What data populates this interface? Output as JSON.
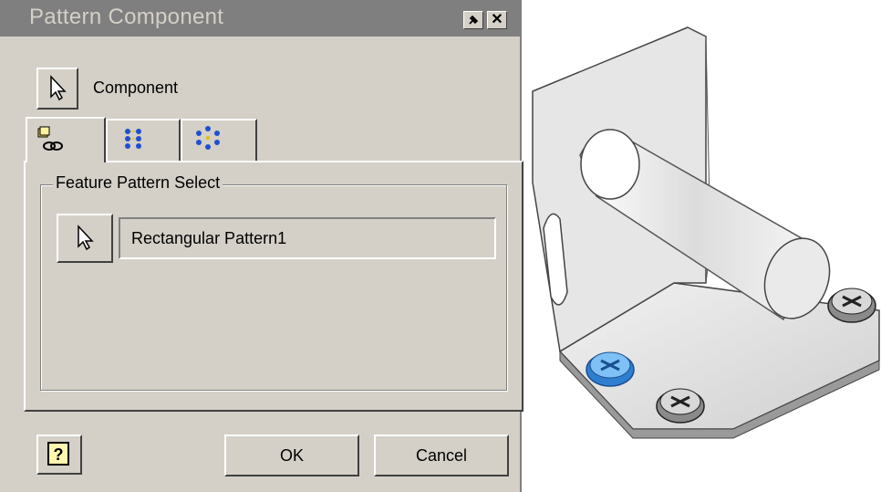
{
  "dialog": {
    "title": "Pattern Component",
    "component_label": "Component",
    "tabs": [
      {
        "icon": "component-pattern-icon"
      },
      {
        "icon": "rectangular-pattern-icon"
      },
      {
        "icon": "circular-pattern-icon"
      }
    ],
    "group_label": "Feature Pattern Select",
    "pattern_field_value": "Rectangular Pattern1",
    "ok_label": "OK",
    "cancel_label": "Cancel"
  },
  "title_buttons": {
    "pin_icon": "pin-icon",
    "close_glyph": "✕"
  },
  "colors": {
    "dialog_face": "#d4d0c8",
    "titlebar": "#7f7f7f",
    "highlight_screw": "#3a8fd8"
  }
}
